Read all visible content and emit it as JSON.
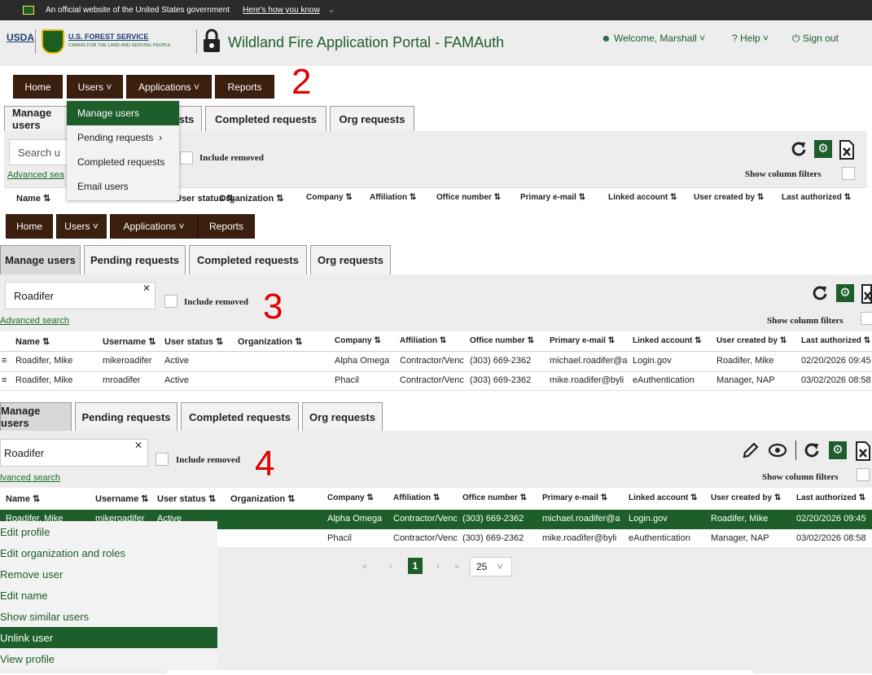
{
  "gov_banner": {
    "text": "An official website of the United States government",
    "how_link": "Here's how you know"
  },
  "header": {
    "usda": "USDA",
    "forest_service": "U.S. FOREST SERVICE",
    "tagline": "CARING FOR THE LAND AND SERVING PEOPLE",
    "app_title": "Wildland Fire Application Portal - FAMAuth",
    "welcome": "Welcome, Marshall",
    "help": "Help",
    "sign_out": "Sign out"
  },
  "nav": {
    "home": "Home",
    "users": "Users",
    "applications": "Applications",
    "reports": "Reports"
  },
  "step_labels": {
    "s2": "2",
    "s3": "3",
    "s4": "4"
  },
  "users_menu": [
    "Manage users",
    "Pending requests",
    "Completed requests",
    "Email users"
  ],
  "tabs": {
    "manage": "Manage users",
    "pending": "Pending requests",
    "completed": "Completed requests",
    "org": "Org requests"
  },
  "panel1": {
    "search_placeholder": "Search u",
    "partial_tab": "sts",
    "adv_partial": "Advanced sea",
    "include_removed": "Include removed",
    "show_filters": "Show column filters"
  },
  "columns1": {
    "name": "Name",
    "status": "User status",
    "organization": "Organization",
    "company": "Company",
    "affiliation": "Affiliation",
    "office": "Office number",
    "email": "Primary e-mail",
    "linked": "Linked account",
    "created": "User created by",
    "last": "Last authorized"
  },
  "panel3": {
    "search_value": "Roadifer",
    "include_removed": "Include removed",
    "advanced": "Advanced search",
    "show_filters": "Show column filters"
  },
  "columns": {
    "name": "Name",
    "username": "Username",
    "status": "User status",
    "organization": "Organization",
    "company": "Company",
    "affiliation": "Affiliation",
    "office": "Office number",
    "email": "Primary e-mail",
    "linked": "Linked account",
    "created": "User created by",
    "last": "Last authorized"
  },
  "rows": [
    {
      "name": "Roadifer, Mike",
      "username": "mikeroadifer",
      "status": "Active",
      "organization": "",
      "company": "Alpha Omega",
      "affiliation": "Contractor/Venc",
      "office": "(303) 669-2362",
      "email": "michael.roadifer@a",
      "linked": "Login.gov",
      "created": "Roadifer, Mike",
      "last": "02/20/2026 09:45"
    },
    {
      "name": "Roadifer, Mike",
      "username": "mroadifer",
      "status": "Active",
      "organization": "",
      "company": "Phacil",
      "affiliation": "Contractor/Venc",
      "office": "(303) 669-2362",
      "email": "mike.roadifer@byli",
      "linked": "eAuthentication",
      "created": "Manager, NAP",
      "last": "03/02/2026 08:58"
    }
  ],
  "panel4": {
    "search_value": "Roadifer",
    "include_removed": "Include removed",
    "advanced_partial": "lvanced search",
    "show_filters": "Show column filters",
    "tab_manage_partial": "Manage users",
    "row1_partial_name": "Roadifer, Mike",
    "row1_partial_username": "mikeroadifer",
    "row1_partial_status": "Active"
  },
  "context_menu": [
    "Edit profile",
    "Edit organization and roles",
    "Remove user",
    "Edit name",
    "Show similar users",
    "Unlink user",
    "View profile"
  ],
  "pagination": {
    "first": "«",
    "prev": "‹",
    "current": "1",
    "next": "›",
    "last": "»",
    "page_size": "25"
  },
  "colors": {
    "green": "#1d5e2a",
    "nav_brown": "#3b1f0f",
    "step_red": "#e00000"
  }
}
